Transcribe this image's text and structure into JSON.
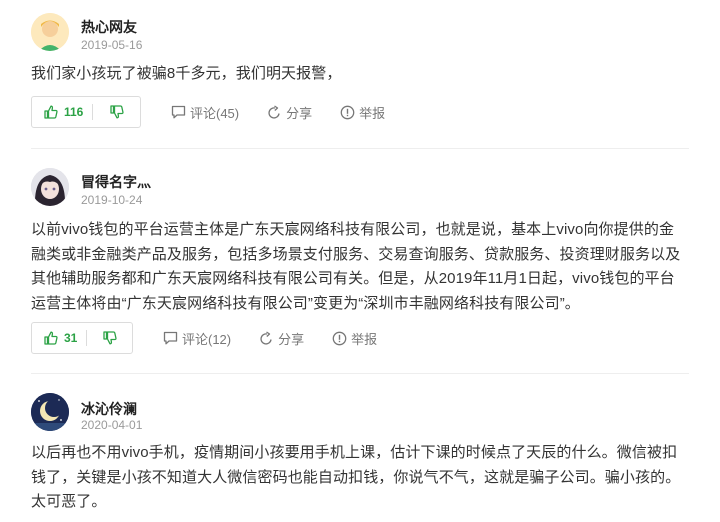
{
  "colors": {
    "accent_green": "#2ba245",
    "text_gray": "#9a9a9a",
    "icon_gray": "#777777"
  },
  "comments": [
    {
      "username": "热心网友",
      "date": "2019-05-16",
      "avatar_icon": "default-user-avatar-icon",
      "text": "我们家小孩玩了被骗8千多元，我们明天报警，",
      "likes": "116",
      "comment_label": "评论(45)",
      "share_label": "分享",
      "report_label": "举报"
    },
    {
      "username": "冒得名字灬",
      "date": "2019-10-24",
      "avatar_icon": "anime-girl-avatar-icon",
      "text": "以前vivo钱包的平台运营主体是广东天宸网络科技有限公司，也就是说，基本上vivo向你提供的金融类或非金融类产品及服务，包括多场景支付服务、交易查询服务、贷款服务、投资理财服务以及其他辅助服务都和广东天宸网络科技有限公司有关。但是，从2019年11月1日起，vivo钱包的平台运营主体将由“广东天宸网络科技有限公司”变更为“深圳市丰融网络科技有限公司”。",
      "likes": "31",
      "comment_label": "评论(12)",
      "share_label": "分享",
      "report_label": "举报"
    },
    {
      "username": "冰沁伶澜",
      "date": "2020-04-01",
      "avatar_icon": "moon-night-avatar-icon",
      "text": "以后再也不用vivo手机，疫情期间小孩要用手机上课，估计下课的时候点了天辰的什么。微信被扣钱了，关键是小孩不知道大人微信密码也能自动扣钱，你说气不气，这就是骗子公司。骗小孩的。太可恶了。"
    }
  ]
}
